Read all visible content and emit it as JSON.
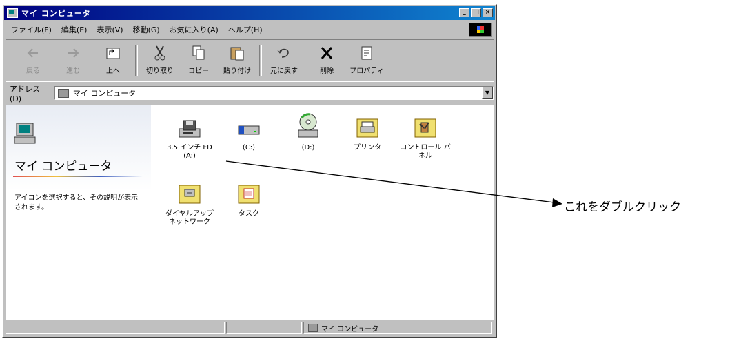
{
  "window": {
    "title": "マイ コンピュータ",
    "buttons": {
      "minimize": "_",
      "maximize": "□",
      "close": "×"
    }
  },
  "menu": [
    "ファイル(F)",
    "編集(E)",
    "表示(V)",
    "移動(G)",
    "お気に入り(A)",
    "ヘルプ(H)"
  ],
  "toolbar": {
    "back": "戻る",
    "forward": "進む",
    "up": "上へ",
    "cut": "切り取り",
    "copy": "コピー",
    "paste": "貼り付け",
    "undo": "元に戻す",
    "delete": "削除",
    "properties": "プロパティ"
  },
  "address": {
    "label": "アドレス(D)",
    "value": "マイ コンピュータ"
  },
  "left_pane": {
    "title": "マイ コンピュータ",
    "description": "アイコンを選択すると、その説明が表示されます。"
  },
  "items": [
    {
      "label": "3.5 インチ FD (A:)",
      "icon": "floppy-drive-icon"
    },
    {
      "label": "(C:)",
      "icon": "hard-drive-icon"
    },
    {
      "label": "(D:)",
      "icon": "cd-drive-icon"
    },
    {
      "label": "プリンタ",
      "icon": "printer-folder-icon"
    },
    {
      "label": "コントロール パネル",
      "icon": "control-panel-folder-icon"
    },
    {
      "label": "ダイヤルアップ ネットワーク",
      "icon": "dialup-folder-icon"
    },
    {
      "label": "タスク",
      "icon": "tasks-folder-icon"
    }
  ],
  "statusbar": {
    "location": "マイ コンピュータ"
  },
  "callout": {
    "text": "これをダブルクリック"
  }
}
